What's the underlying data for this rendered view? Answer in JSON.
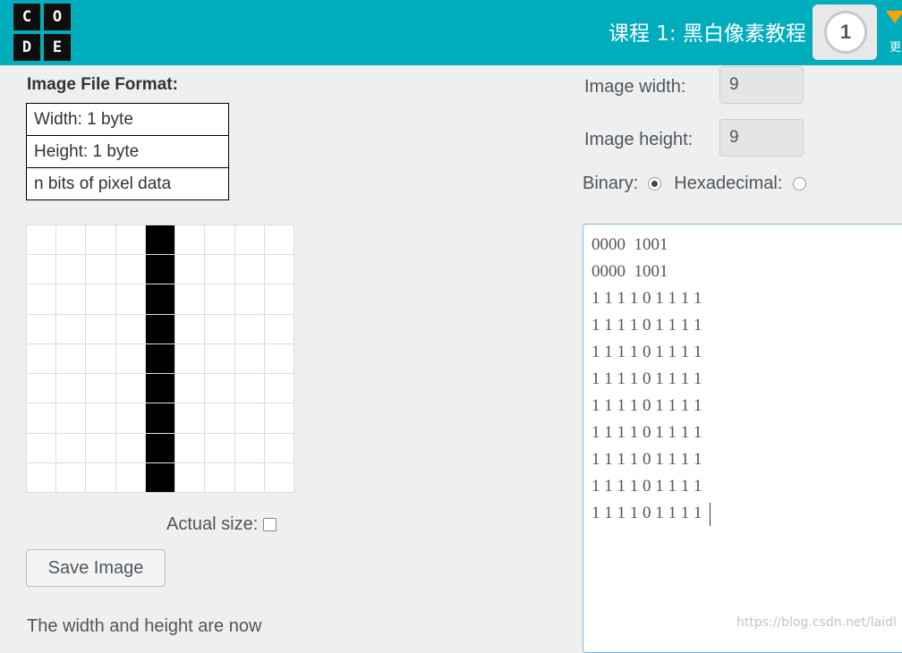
{
  "header": {
    "logo_letters": [
      "C",
      "O",
      "D",
      "E"
    ],
    "lesson_title": "课程 1: 黑白像素教程",
    "progress_number": "1",
    "more_label": "更",
    "bg_color": "#00adbc",
    "more_arrow_color": "#ffa400"
  },
  "format": {
    "title": "Image File Format:",
    "rows": [
      "Width: 1 byte",
      "Height: 1 byte",
      "n bits of pixel data"
    ]
  },
  "grid": {
    "cols": 9,
    "rows": 9,
    "pixels": [
      [
        0,
        0,
        0,
        0,
        1,
        0,
        0,
        0,
        0
      ],
      [
        0,
        0,
        0,
        0,
        1,
        0,
        0,
        0,
        0
      ],
      [
        0,
        0,
        0,
        0,
        1,
        0,
        0,
        0,
        0
      ],
      [
        0,
        0,
        0,
        0,
        1,
        0,
        0,
        0,
        0
      ],
      [
        0,
        0,
        0,
        0,
        1,
        0,
        0,
        0,
        0
      ],
      [
        0,
        0,
        0,
        0,
        1,
        0,
        0,
        0,
        0
      ],
      [
        0,
        0,
        0,
        0,
        1,
        0,
        0,
        0,
        0
      ],
      [
        0,
        0,
        0,
        0,
        1,
        0,
        0,
        0,
        0
      ],
      [
        0,
        0,
        0,
        0,
        1,
        0,
        0,
        0,
        0
      ]
    ]
  },
  "actual_size_label": "Actual size:",
  "save_button_label": "Save Image",
  "info_text": "The width and height are now",
  "dimensions": {
    "width_label": "Image width:",
    "width_value": "9",
    "height_label": "Image height:",
    "height_value": "9"
  },
  "mode": {
    "binary_label": "Binary:",
    "hex_label": "Hexadecimal:",
    "selected": "binary"
  },
  "bits_lines": [
    "0000  1001",
    "0000  1001",
    "1 1 1 1 0 1 1 1 1",
    "1 1 1 1 0 1 1 1 1",
    "1 1 1 1 0 1 1 1 1",
    "1 1 1 1 0 1 1 1 1",
    "1 1 1 1 0 1 1 1 1",
    "1 1 1 1 0 1 1 1 1",
    "1 1 1 1 0 1 1 1 1",
    "1 1 1 1 0 1 1 1 1",
    "1 1 1 1 0 1 1 1 1"
  ],
  "watermark": "https://blog.csdn.net/laidl"
}
